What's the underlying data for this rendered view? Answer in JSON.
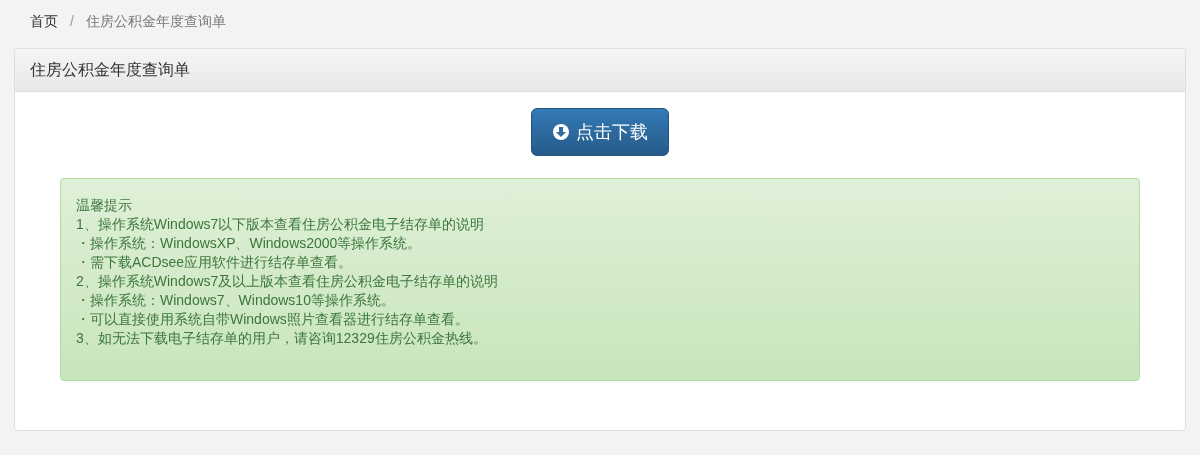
{
  "breadcrumb": [
    {
      "label": "首页",
      "kind": "link"
    },
    {
      "label": "/",
      "kind": "separator"
    },
    {
      "label": "住房公积金年度查询单",
      "kind": "current"
    }
  ],
  "panel": {
    "title": "住房公积金年度查询单",
    "button": "点击下载",
    "notice": {
      "title": "温馨提示",
      "lines": [
        "1、操作系统Windows7以下版本查看住房公积金电子结存单的说明",
        "・操作系统：WindowsXP、Windows2000等操作系统。",
        "・需下载ACDsee应用软件进行结存单查看。",
        "2、操作系统Windows7及以上版本查看住房公积金电子结存单的说明",
        "・操作系统：Windows7、Windows10等操作系统。",
        "・可以直接使用系统自带Windows照片查看器进行结存单查看。",
        "3、如无法下载电子结存单的用户，请咨询12329住房公积金热线。"
      ]
    }
  }
}
